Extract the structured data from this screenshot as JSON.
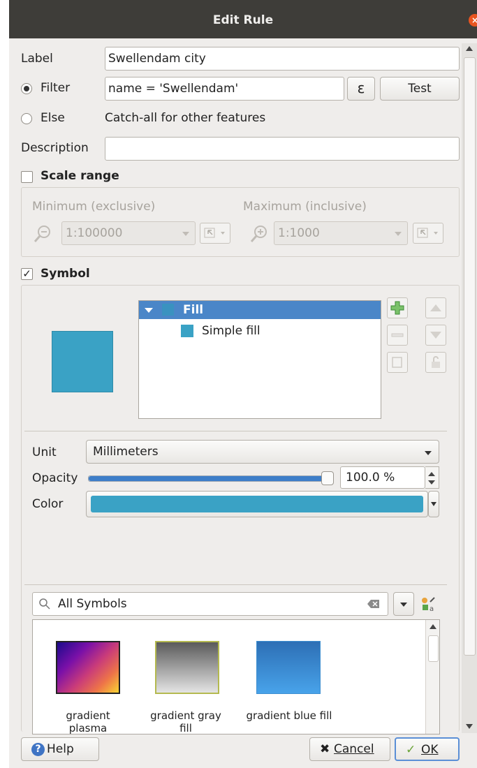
{
  "window": {
    "title": "Edit Rule",
    "close_glyph": "×"
  },
  "label_row": {
    "label": "Label",
    "value": "Swellendam city"
  },
  "filter_row": {
    "label": "Filter",
    "value": "name = 'Swellendam'",
    "expr_glyph": "ε",
    "test_label": "Test"
  },
  "else_row": {
    "label": "Else",
    "text": "Catch-all for other features"
  },
  "description_row": {
    "label": "Description",
    "value": ""
  },
  "scale_range": {
    "label": "Scale range",
    "checked": false,
    "min_label": "Minimum (exclusive)",
    "min_value": "1:100000",
    "max_label": "Maximum (inclusive)",
    "max_value": "1:1000"
  },
  "symbol": {
    "label": "Symbol",
    "checked": true,
    "layers": [
      {
        "label": "Fill"
      },
      {
        "label": "Simple fill"
      }
    ],
    "unit_label": "Unit",
    "unit_value": "Millimeters",
    "opacity_label": "Opacity",
    "opacity_value": "100.0 %",
    "opacity_fraction": 1.0,
    "color_label": "Color",
    "color": "#3aa2c5"
  },
  "library": {
    "search_value": "All Symbols",
    "items": [
      {
        "label1": "gradient",
        "label2": "plasma"
      },
      {
        "label1": "gradient  gray",
        "label2": "fill"
      },
      {
        "label1": "gradient blue fill",
        "label2": ""
      }
    ]
  },
  "buttons": {
    "help": "Help",
    "cancel": "Cancel",
    "ok": "OK"
  },
  "colors": {
    "accent": "#3d7ec9",
    "selection": "#4a86c8",
    "swatch": "#3aa2c5"
  }
}
